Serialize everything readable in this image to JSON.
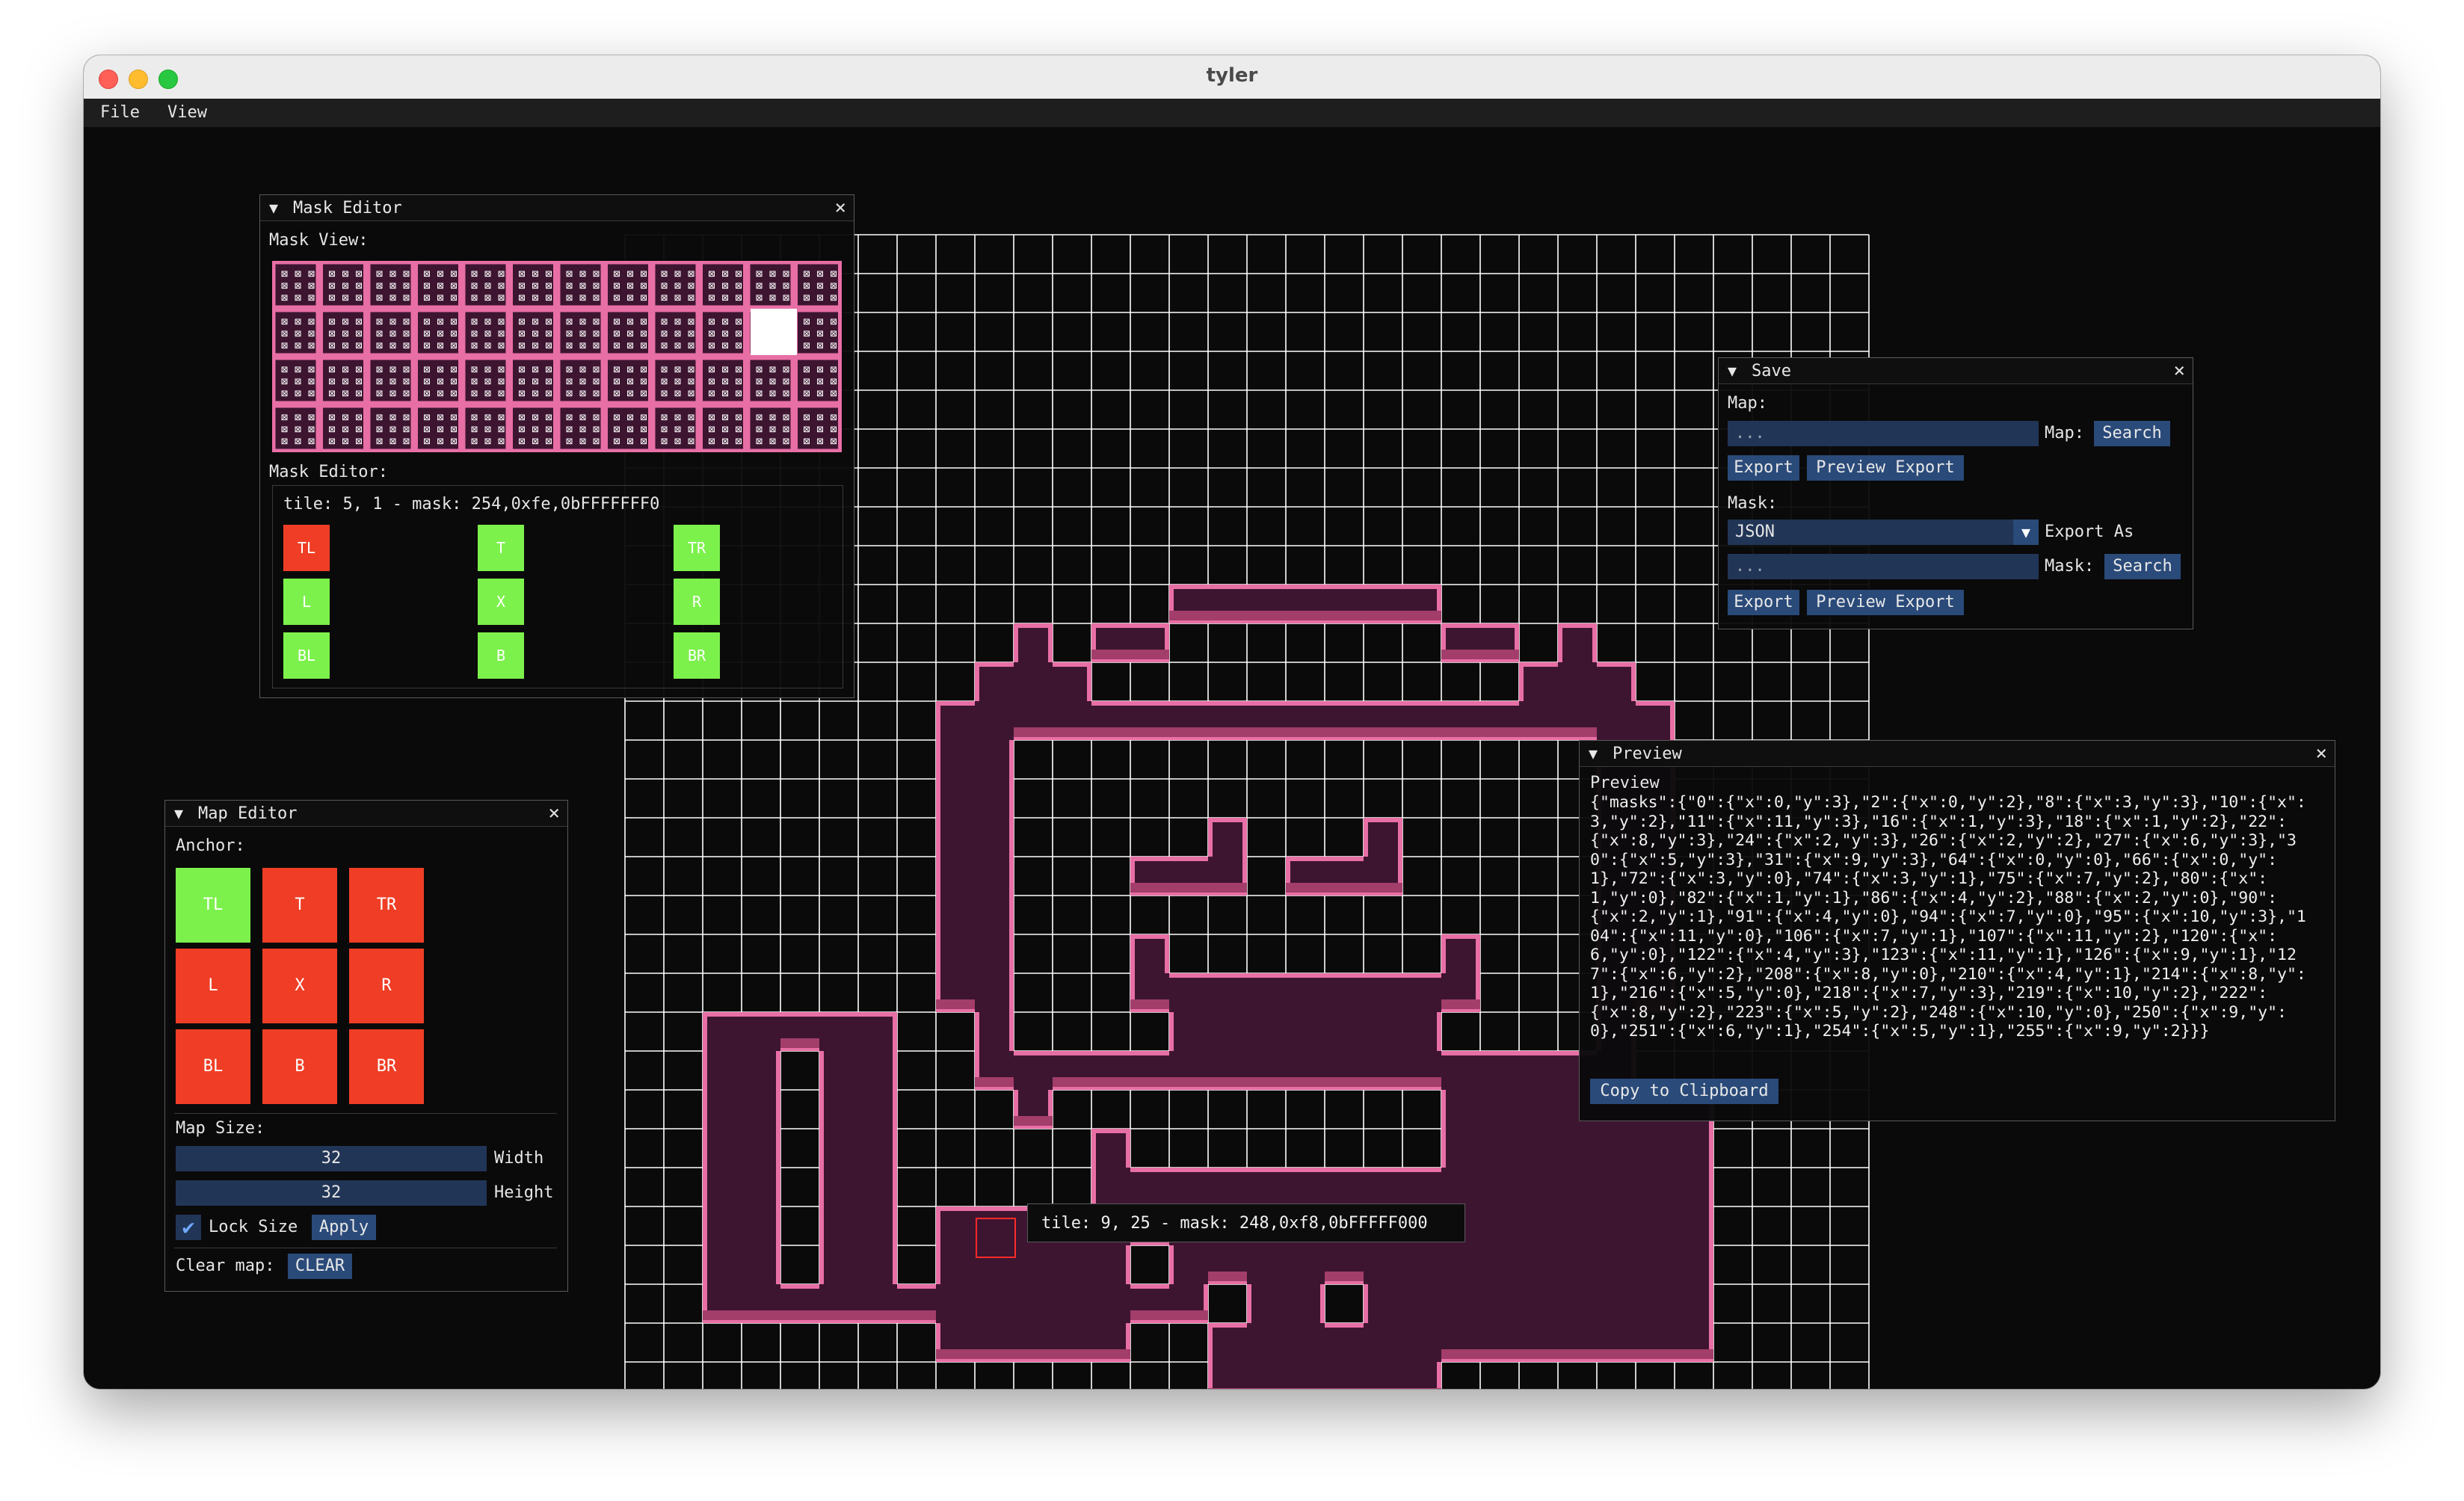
{
  "window": {
    "title": "tyler"
  },
  "menu": [
    "File",
    "View"
  ],
  "colors": {
    "grid": "#ffffff",
    "tile_fill": "#3d1530",
    "tile_edge": "#e86fa5",
    "tile_shadow": "#a33d6a",
    "toggle_on": "#7cf14b",
    "toggle_off": "#ef3e25",
    "button": "#2a4a79"
  },
  "mask_editor": {
    "title": "Mask Editor",
    "view_label": "Mask View:",
    "editor_label": "Mask Editor:",
    "tile_info": "tile: 5, 1 - mask: 254,0xfe,0bFFFFFFF0",
    "buttons": [
      {
        "label": "TL",
        "active": false
      },
      {
        "label": "T",
        "active": true
      },
      {
        "label": "TR",
        "active": true
      },
      {
        "label": "L",
        "active": true
      },
      {
        "label": "X",
        "active": true
      },
      {
        "label": "R",
        "active": true
      },
      {
        "label": "BL",
        "active": true
      },
      {
        "label": "B",
        "active": true
      },
      {
        "label": "BR",
        "active": true
      }
    ]
  },
  "map_editor": {
    "title": "Map Editor",
    "anchor_label": "Anchor:",
    "anchors": [
      {
        "label": "TL",
        "active": true
      },
      {
        "label": "T",
        "active": false
      },
      {
        "label": "TR",
        "active": false
      },
      {
        "label": "L",
        "active": false
      },
      {
        "label": "X",
        "active": false
      },
      {
        "label": "R",
        "active": false
      },
      {
        "label": "BL",
        "active": false
      },
      {
        "label": "B",
        "active": false
      },
      {
        "label": "BR",
        "active": false
      }
    ],
    "size_label": "Map Size:",
    "width_value": "32",
    "width_label": "Width",
    "height_value": "32",
    "height_label": "Height",
    "lock_label": "Lock Size",
    "lock_checked": true,
    "apply_label": "Apply",
    "clear_label": "Clear map:",
    "clear_button": "CLEAR"
  },
  "save": {
    "title": "Save",
    "map_label": "Map:",
    "map_placeholder": "...",
    "map_inline_label": "Map:",
    "search_label": "Search",
    "export_label": "Export",
    "preview_export_label": "Preview Export",
    "mask_label": "Mask:",
    "format_value": "JSON",
    "export_as_label": "Export As",
    "mask_placeholder": "...",
    "mask_inline_label": "Mask:"
  },
  "preview": {
    "title": "Preview",
    "label": "Preview",
    "json": "{\"masks\":{\"0\":{\"x\":0,\"y\":3},\"2\":{\"x\":0,\"y\":2},\"8\":{\"x\":3,\"y\":3},\"10\":{\"x\":3,\"y\":2},\"11\":{\"x\":11,\"y\":3},\"16\":{\"x\":1,\"y\":3},\"18\":{\"x\":1,\"y\":2},\"22\":{\"x\":8,\"y\":3},\"24\":{\"x\":2,\"y\":3},\"26\":{\"x\":2,\"y\":2},\"27\":{\"x\":6,\"y\":3},\"30\":{\"x\":5,\"y\":3},\"31\":{\"x\":9,\"y\":3},\"64\":{\"x\":0,\"y\":0},\"66\":{\"x\":0,\"y\":1},\"72\":{\"x\":3,\"y\":0},\"74\":{\"x\":3,\"y\":1},\"75\":{\"x\":7,\"y\":2},\"80\":{\"x\":1,\"y\":0},\"82\":{\"x\":1,\"y\":1},\"86\":{\"x\":4,\"y\":2},\"88\":{\"x\":2,\"y\":0},\"90\":{\"x\":2,\"y\":1},\"91\":{\"x\":4,\"y\":0},\"94\":{\"x\":7,\"y\":0},\"95\":{\"x\":10,\"y\":3},\"104\":{\"x\":11,\"y\":0},\"106\":{\"x\":7,\"y\":1},\"107\":{\"x\":11,\"y\":2},\"120\":{\"x\":6,\"y\":0},\"122\":{\"x\":4,\"y\":3},\"123\":{\"x\":11,\"y\":1},\"126\":{\"x\":9,\"y\":1},\"127\":{\"x\":6,\"y\":2},\"208\":{\"x\":8,\"y\":0},\"210\":{\"x\":4,\"y\":1},\"214\":{\"x\":8,\"y\":1},\"216\":{\"x\":5,\"y\":0},\"218\":{\"x\":7,\"y\":3},\"219\":{\"x\":10,\"y\":2},\"222\":{\"x\":8,\"y\":2},\"223\":{\"x\":5,\"y\":2},\"248\":{\"x\":10,\"y\":0},\"250\":{\"x\":9,\"y\":0},\"251\":{\"x\":6,\"y\":1},\"254\":{\"x\":5,\"y\":1},\"255\":{\"x\":9,\"y\":2}}}",
    "copy_label": "Copy to Clipboard"
  },
  "tooltip": "tile: 9, 25 - mask: 248,0xf8,0bFFFFF000"
}
